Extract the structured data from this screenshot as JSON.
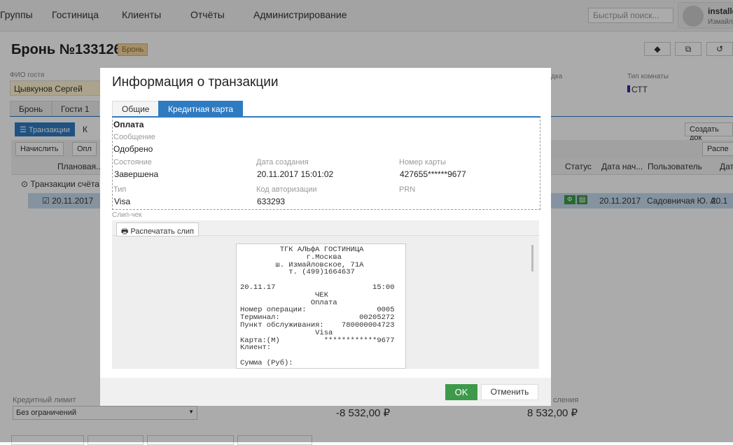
{
  "nav": {
    "items": [
      "Группы",
      "Гостиница",
      "Клиенты",
      "Отчёты",
      "Администрирование"
    ],
    "search_placeholder": "Быстрый поиск...",
    "user_name": "installer",
    "user_sub": "Измайло"
  },
  "page": {
    "title": "Бронь №133126",
    "badge": "Бронь",
    "guest_label": "ФИО гостя",
    "guest_value": "Цывкунов Сергей",
    "discount_label": "Скидка",
    "room_type_label": "Тип комнаты",
    "room_type_value": "СТТ",
    "tabs": [
      "Бронь",
      "Гости 1"
    ],
    "subtab_transactions": "Транзакции",
    "subtab_other": "К",
    "btn_charge": "Начислить",
    "btn_pay": "Опл",
    "btn_create_doc": "Создать док",
    "btn_print": "Распе",
    "columns": [
      "Плановая...",
      "Статус",
      "Дата нач...",
      "Пользователь",
      "Дат"
    ],
    "group": "Транзакции счёта",
    "row": {
      "date": "20.11.2017",
      "status_f": "Ф",
      "start": "20.11.2017",
      "user": "Садовничая Ю. А.",
      "date2": "20.1"
    },
    "credit_limit_label": "Кредитный лимит",
    "credit_limit_value": "Без ограничений",
    "balance": "-8 532,00 ₽",
    "accrual_label": "сления",
    "accrual_value": "8 532,00 ₽"
  },
  "modal": {
    "title": "Информация о транзакции",
    "tabs": [
      "Общие",
      "Кредитная карта"
    ],
    "section": "Оплата",
    "message_label": "Сообщение",
    "message": "Одобрено",
    "state_label": "Состояние",
    "state": "Завершена",
    "created_label": "Дата создания",
    "created": "20.11.2017 15:01:02",
    "card_label": "Номер карты",
    "card": "427655******9677",
    "type_label": "Тип",
    "type": "Visa",
    "auth_label": "Код авторизации",
    "auth": "633293",
    "prn_label": "PRN",
    "slip_label": "Слип-чек",
    "print_slip": "Распечатать слип",
    "receipt": "         ТГК АЛЬфА ГОСТИНИЦА\n               г.Москва\n        ш. Измайловское, 71А\n           т. (499)1664637\n\n20.11.17                      15:00\n                 ЧЕК\n                Оплата\nНомер операции:                0005\nТерминал:                  00205272\nПункт обслуживания:    780000004723\n                 Visa\nКарта:(M)          ************9677\nКлиент:\n\nСумма (Руб):",
    "ok": "OK",
    "cancel": "Отменить"
  }
}
